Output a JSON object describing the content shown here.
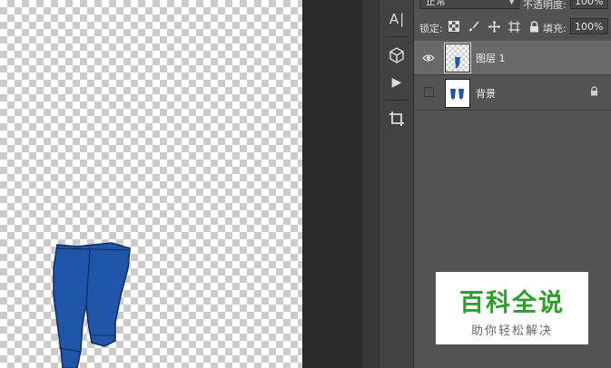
{
  "canvas": {
    "artwork": "blue-pants"
  },
  "toolbar": {
    "tools": [
      {
        "icon": "type-tool-icon",
        "glyph": "A|"
      },
      {
        "icon": "3d-cube-icon",
        "glyph": ""
      },
      {
        "icon": "play-icon",
        "glyph": "▶"
      },
      {
        "icon": "crop-icon",
        "glyph": ""
      }
    ]
  },
  "layers_panel": {
    "blend_mode": "正常",
    "opacity_label": "不透明度:",
    "opacity_value": "100%",
    "lock_label": "锁定:",
    "fill_label": "填充:",
    "fill_value": "100%",
    "layers": [
      {
        "name": "图层 1",
        "visible": true,
        "selected": true,
        "locked": false
      },
      {
        "name": "背景",
        "visible": false,
        "selected": false,
        "locked": true
      }
    ]
  },
  "watermark": {
    "title": "百科全说",
    "subtitle": "助你轻松解决",
    "color": "#2aa02a"
  }
}
